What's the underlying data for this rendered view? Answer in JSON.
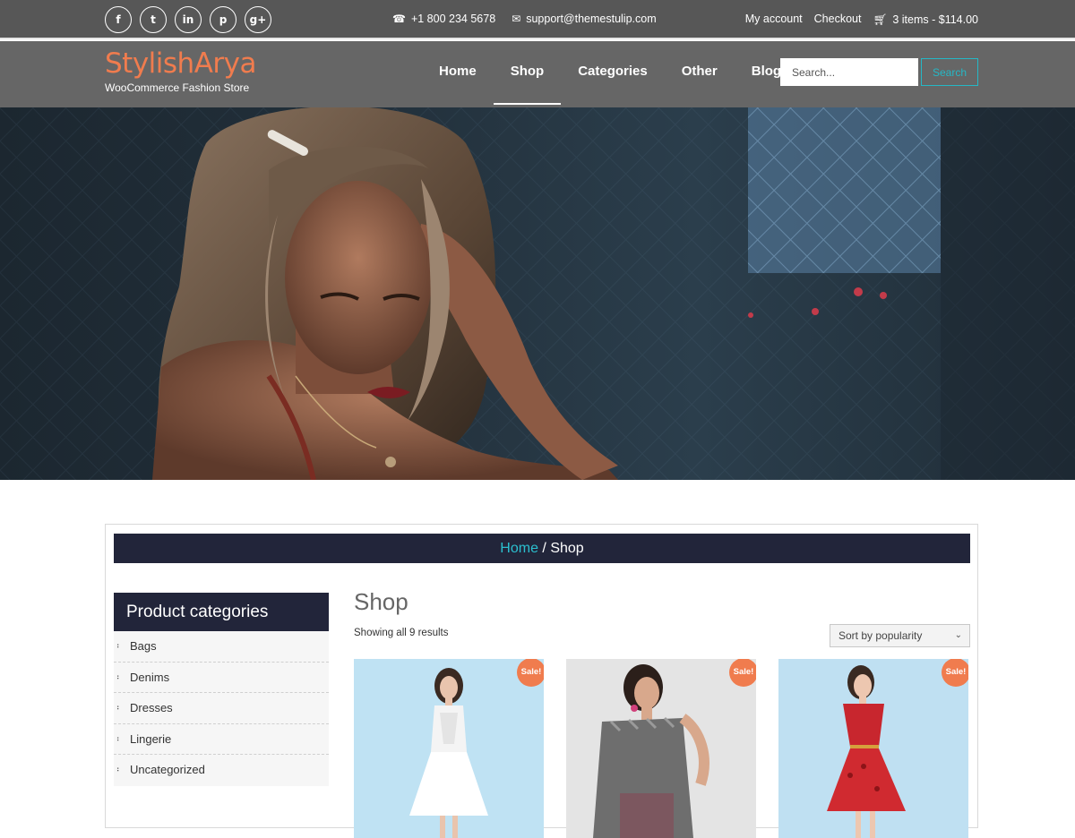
{
  "topbar": {
    "social": [
      {
        "icon": "facebook-icon",
        "glyph": "f"
      },
      {
        "icon": "twitter-icon",
        "glyph": "t"
      },
      {
        "icon": "linkedin-icon",
        "glyph": "in"
      },
      {
        "icon": "pinterest-icon",
        "glyph": "p"
      },
      {
        "icon": "google-plus-icon",
        "glyph": "g+"
      }
    ],
    "phone": "+1 800 234 5678",
    "email": "support@themestulip.com",
    "my_account": "My account",
    "checkout": "Checkout",
    "cart": "3 items - $114.00"
  },
  "header": {
    "logo": "StylishArya",
    "tagline": "WooCommerce Fashion Store",
    "nav": [
      "Home",
      "Shop",
      "Categories",
      "Other",
      "Blog"
    ],
    "active_nav": "Shop",
    "search_placeholder": "Search...",
    "search_button": "Search"
  },
  "breadcrumb": {
    "home": "Home",
    "separator": " / ",
    "current": "Shop"
  },
  "sidebar": {
    "title": "Product categories",
    "items": [
      "Bags",
      "Denims",
      "Dresses",
      "Lingerie",
      "Uncategorized"
    ]
  },
  "main": {
    "title": "Shop",
    "result_count": "Showing all 9 results",
    "sort_label": "Sort by popularity"
  },
  "products": [
    {
      "badge": "Sale!"
    },
    {
      "badge": "Sale!"
    },
    {
      "badge": "Sale!"
    }
  ],
  "colors": {
    "accent": "#f07c4e",
    "link": "#2bbfcf",
    "dark": "#22253a"
  }
}
